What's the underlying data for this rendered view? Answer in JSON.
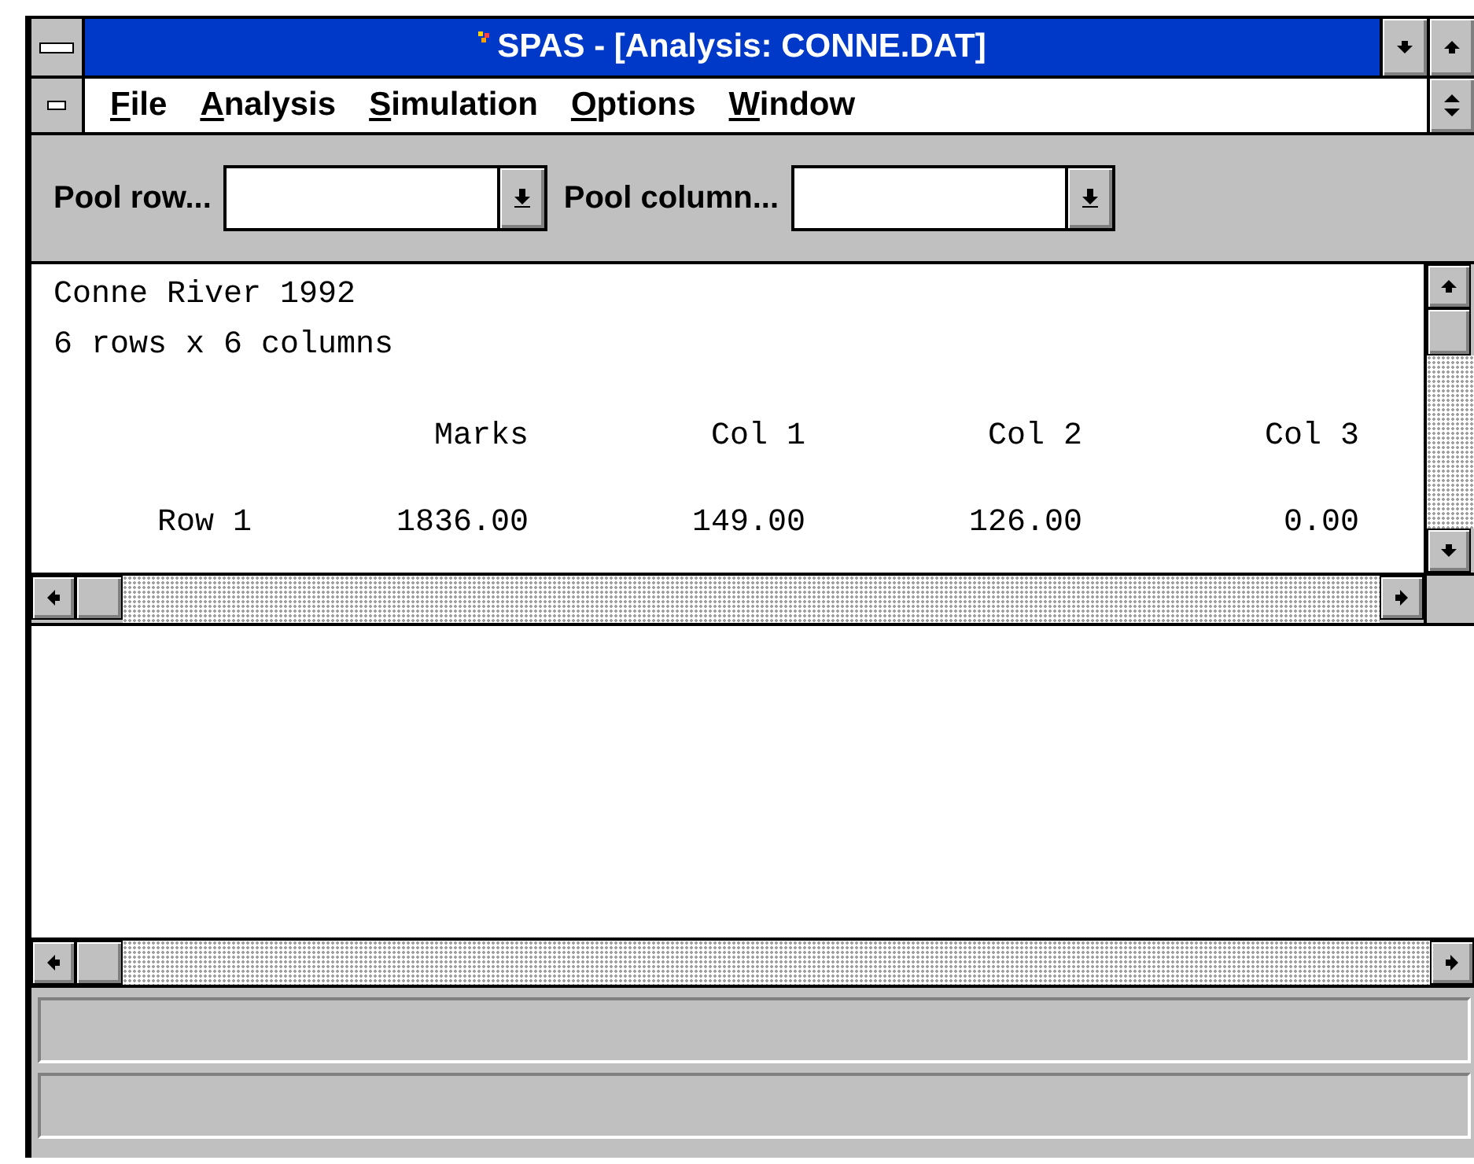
{
  "window": {
    "title": "SPAS - [Analysis: CONNE.DAT]"
  },
  "menu": [
    {
      "label": "File"
    },
    {
      "label": "Analysis"
    },
    {
      "label": "Simulation"
    },
    {
      "label": "Options"
    },
    {
      "label": "Window"
    }
  ],
  "toolbar": [
    {
      "label": "Pool row..."
    },
    {
      "label": "Pool column..."
    }
  ],
  "report": {
    "heading": "Conne River 1992",
    "subheading": "6 rows x 6 columns",
    "columns": [
      "Marks",
      "Col 1",
      "Col 2",
      "Col 3"
    ],
    "rows": [
      {
        "label": "Row 1",
        "values": [
          "1836.00",
          "149.00",
          "126.00",
          "0.00"
        ]
      }
    ]
  }
}
